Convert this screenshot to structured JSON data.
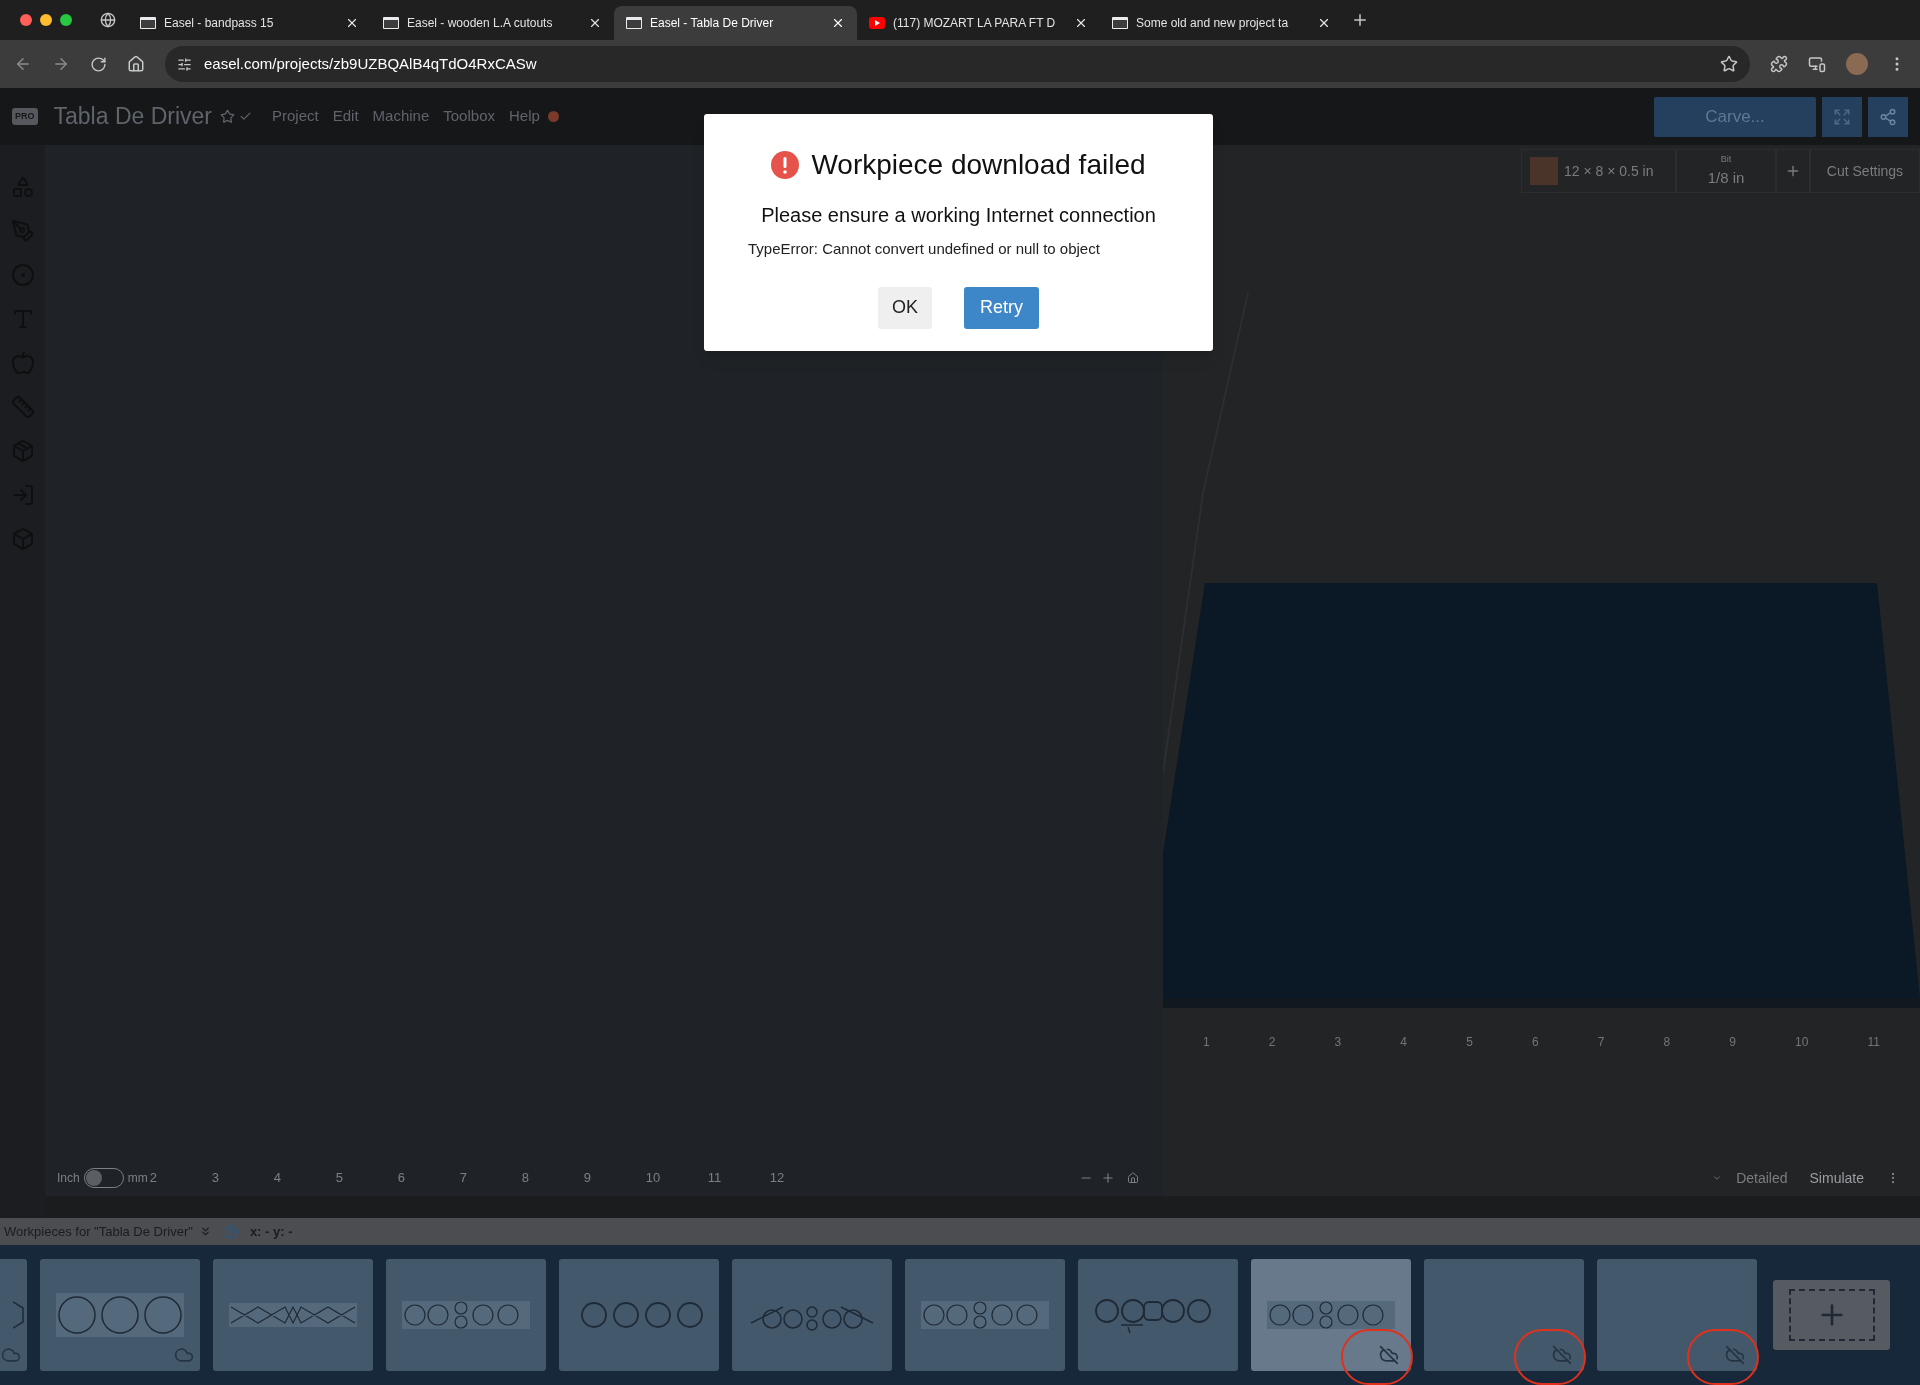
{
  "browser": {
    "tabs": [
      {
        "title": "Easel - bandpass 15",
        "kind": "page",
        "selected": false
      },
      {
        "title": "Easel - wooden L.A cutouts",
        "kind": "page",
        "selected": false
      },
      {
        "title": "Easel - Tabla De Driver",
        "kind": "page",
        "selected": true
      },
      {
        "title": "(117) MOZART LA PARA FT D",
        "kind": "video",
        "selected": false
      },
      {
        "title": "Some old and new project ta",
        "kind": "page",
        "selected": false
      }
    ],
    "url": "easel.com/projects/zb9UZBQAlB4qTdO4RxCASw"
  },
  "app": {
    "badge": "PRO",
    "title": "Tabla De Driver",
    "menu": [
      "Project",
      "Edit",
      "Machine",
      "Toolbox",
      "Help"
    ],
    "carve_button": "Carve...",
    "material": "12 × 8 × 0.5 in",
    "bit_label": "Bit",
    "bit_value": "1/8 in",
    "cut_settings": "Cut Settings",
    "unit_left": "Inch",
    "unit_right": "mm",
    "metric": false,
    "ruler": [
      "2",
      "3",
      "4",
      "5",
      "6",
      "7",
      "8",
      "9",
      "10",
      "11",
      "12"
    ],
    "view_ruler": [
      "1",
      "2",
      "3",
      "4",
      "5",
      "6",
      "7",
      "8",
      "9",
      "10",
      "11"
    ],
    "detailed": "Detailed",
    "simulate": "Simulate",
    "workpieces_title": "Workpieces for \"Tabla De Driver\"",
    "coords": "x: - y: -",
    "workpieces": [
      {
        "kind": "partial",
        "synced": true,
        "offline": false,
        "selected": false,
        "annotated": false
      },
      {
        "kind": "circles",
        "synced": true,
        "offline": false,
        "selected": false,
        "annotated": false
      },
      {
        "kind": "zigzag",
        "synced": false,
        "offline": false,
        "selected": false,
        "annotated": false
      },
      {
        "kind": "stacked",
        "synced": false,
        "offline": false,
        "selected": false,
        "annotated": false
      },
      {
        "kind": "row",
        "synced": false,
        "offline": false,
        "selected": false,
        "annotated": false
      },
      {
        "kind": "arcs",
        "synced": false,
        "offline": false,
        "selected": false,
        "annotated": false
      },
      {
        "kind": "stacked",
        "synced": false,
        "offline": false,
        "selected": false,
        "annotated": false
      },
      {
        "kind": "linked",
        "synced": false,
        "offline": false,
        "selected": false,
        "annotated": false
      },
      {
        "kind": "stacked",
        "synced": false,
        "offline": true,
        "selected": true,
        "annotated": true
      },
      {
        "kind": "empty",
        "synced": false,
        "offline": true,
        "selected": false,
        "annotated": true
      },
      {
        "kind": "empty",
        "synced": false,
        "offline": true,
        "selected": false,
        "annotated": true
      }
    ]
  },
  "dialog": {
    "title": "Workpiece download failed",
    "message": "Please ensure a working Internet connection",
    "error": "TypeError: Cannot convert undefined or null to object",
    "buttons": [
      {
        "label": "OK",
        "kind": "secondary"
      },
      {
        "label": "Retry",
        "kind": "primary"
      }
    ]
  }
}
